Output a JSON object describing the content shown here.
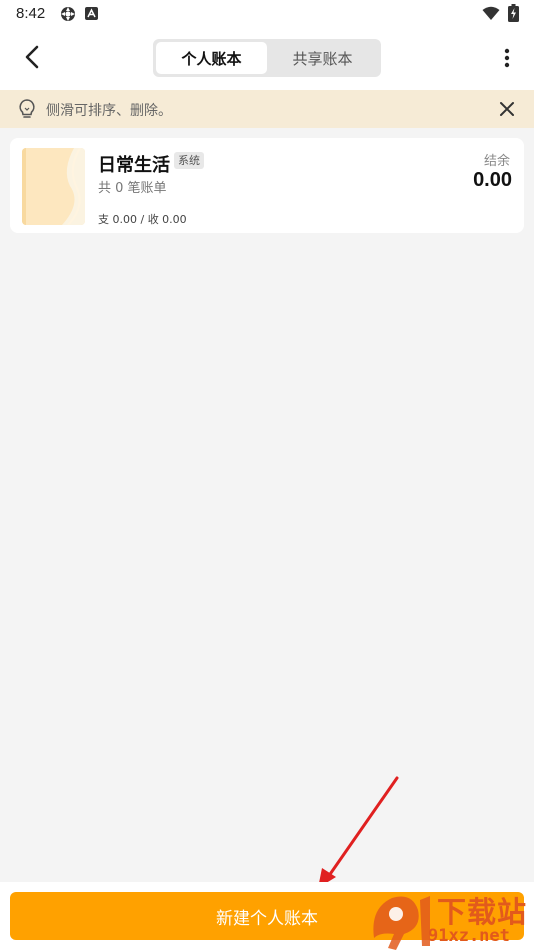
{
  "status_bar": {
    "time": "8:42"
  },
  "header": {
    "tabs": [
      {
        "label": "个人账本",
        "active": true
      },
      {
        "label": "共享账本",
        "active": false
      }
    ]
  },
  "tip": {
    "text": "侧滑可排序、删除。"
  },
  "ledgers": [
    {
      "name": "日常生活",
      "badge": "系统",
      "count_text": "共 0 笔账单",
      "summary": "支 0.00 / 收 0.00",
      "balance_label": "结余",
      "balance_value": "0.00"
    }
  ],
  "footer": {
    "new_button_label": "新建个人账本"
  },
  "watermark": {
    "title": "下载站",
    "site": "91xz.net"
  },
  "colors": {
    "accent": "#ffa100",
    "tip_background": "#f6ebd6",
    "page_background": "#f4f4f4",
    "annotation_arrow": "#e02020",
    "watermark": "#e25a1c"
  }
}
